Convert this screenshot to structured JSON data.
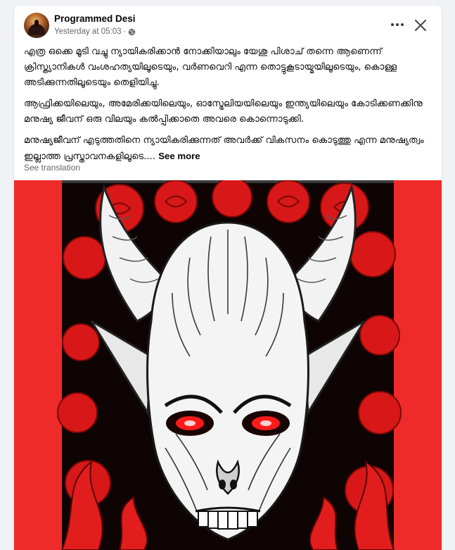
{
  "post": {
    "author_name": "Programmed Desi",
    "timestamp": "Yesterday at 05:03",
    "separator": "·",
    "privacy_icon": "globe-icon",
    "paragraphs": [
      "എത്ര ഒക്കെ മൂടി വച്ചു ന്യായികരിക്കാൻ നോക്കിയാലും യേശു പിശാച് തന്നെ ആണെന്ന് ക്രിസ്ത്യാനികൾ വംശഹത്യയിലൂടെയും, വർണവെറി എന്ന തൊട്ടുകൂടായ്മയിലൂടെയും, കൊള്ള അടിക്കുന്നതിലൂടെയും തെളിയിച്ചു.",
      "ആഫ്രിക്കയിലെയും, അമേരിക്കയിലെയും, ഓസ്ട്രേലിയയിലെയും ഇന്ത്യയിലെയും കോടിക്കണക്കിനു മനുഷ്യ ജീവന് ഒരു വിലയും കൽപ്പിക്കാതെ അവരെ കൊന്നൊടുക്കി.",
      "മനുഷ്യജീവന് എടുത്തതിനെ ന്യായികരിക്കുന്നത് അവർക്ക് വികസനം കൊടുത്തു എന്ന മനുഷ്യത്വം ഇല്ലാത്ത പ്രസ്താവനകളിലൂടെ...."
    ],
    "see_more_label": "See more",
    "see_translation_label": "See translation"
  },
  "icons": {
    "more": "more-options-icon",
    "close": "close-icon"
  },
  "image": {
    "subject": "demon-illustration",
    "background_color": "#ee2a2a",
    "eye_color": "#ff1a1a"
  }
}
